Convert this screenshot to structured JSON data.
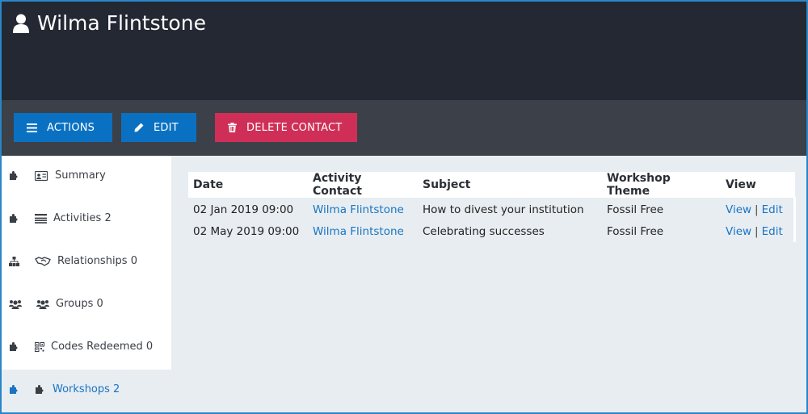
{
  "header": {
    "title": "Wilma Flintstone"
  },
  "toolbar": {
    "actions_label": "ACTIONS",
    "edit_label": "EDIT",
    "delete_label": "DELETE CONTACT"
  },
  "sidebar": {
    "items": [
      {
        "label": "Summary",
        "icon": "contact-card-icon"
      },
      {
        "label": "Activities 2",
        "icon": "list-icon"
      },
      {
        "label": "Relationships 0",
        "icon": "handshake-icon"
      },
      {
        "label": "Groups 0",
        "icon": "users-icon"
      },
      {
        "label": "Codes Redeemed 0",
        "icon": "qr-code-icon"
      },
      {
        "label": "Workshops 2",
        "icon": "puzzle-icon",
        "active": true
      }
    ]
  },
  "table": {
    "columns": [
      "Date",
      "Activity Contact",
      "Subject",
      "Workshop Theme",
      "View"
    ],
    "rows": [
      {
        "date": "02 Jan 2019 09:00",
        "contact": "Wilma Flintstone",
        "subject": "How to divest your institution",
        "theme": "Fossil Free",
        "view": "View",
        "edit": "Edit"
      },
      {
        "date": "02 May 2019 09:00",
        "contact": "Wilma Flintstone",
        "subject": "Celebrating successes",
        "theme": "Fossil Free",
        "view": "View",
        "edit": "Edit"
      }
    ],
    "separator": "|"
  },
  "colors": {
    "header_bg": "#232833",
    "toolbar_bg": "#3b4049",
    "primary": "#0a71c2",
    "danger": "#cf2f56",
    "link": "#1875c4"
  }
}
